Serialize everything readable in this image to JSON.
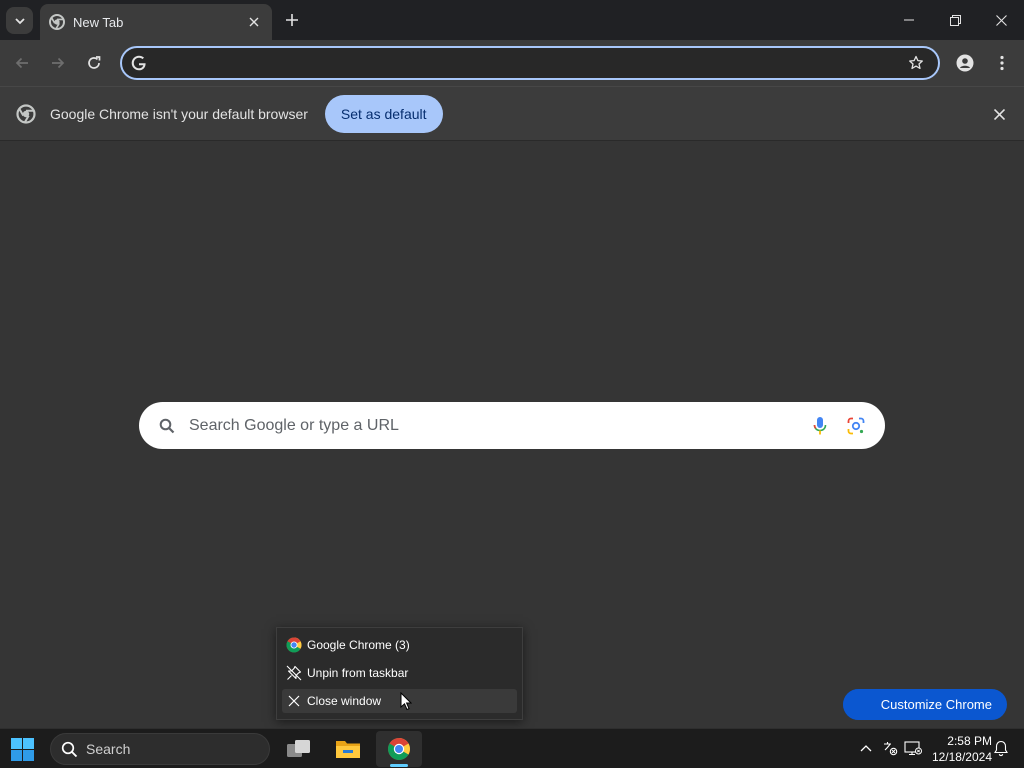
{
  "browser": {
    "tab": {
      "title": "New Tab"
    },
    "omnibox": {
      "value": "",
      "placeholder": ""
    },
    "infobar": {
      "message": "Google Chrome isn't your default browser",
      "button_label": "Set as default"
    }
  },
  "ntp": {
    "search_placeholder": "Search Google or type a URL",
    "customize_label": "Customize Chrome"
  },
  "jumplist": {
    "items": [
      {
        "label": "Google Chrome (3)",
        "icon": "chrome-icon"
      },
      {
        "label": "Unpin from taskbar",
        "icon": "unpin-icon"
      },
      {
        "label": "Close window",
        "icon": "close-icon"
      }
    ]
  },
  "taskbar": {
    "search_label": "Search",
    "time": "2:58 PM",
    "date": "12/18/2024"
  },
  "colors": {
    "accent": "#a8c7fa",
    "customize_button": "#0b57d0",
    "taskbar_indicator": "#60cdff"
  }
}
